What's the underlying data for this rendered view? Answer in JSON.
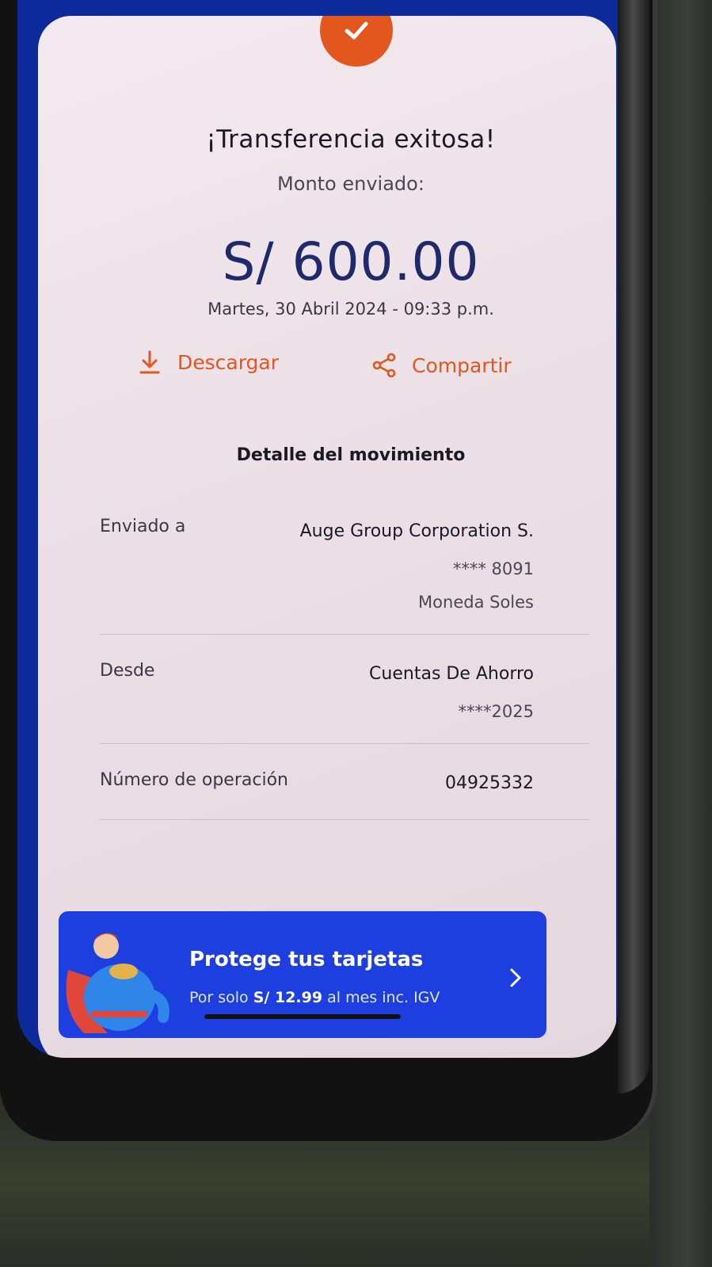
{
  "colors": {
    "accent": "#e3561e",
    "navy": "#1f2a6b",
    "banner_blue": "#1d3fe0",
    "card_bg": "#f3e9ee"
  },
  "status_icon": "check-icon",
  "header": {
    "title": "¡Transferencia exitosa!",
    "subtitle": "Monto enviado:",
    "amount": "S/ 600.00",
    "datetime": "Martes, 30 Abril 2024 - 09:33 p.m."
  },
  "actions": {
    "download_label": "Descargar",
    "download_icon": "download-icon",
    "share_label": "Compartir",
    "share_icon": "share-icon"
  },
  "detail": {
    "section_title": "Detalle del movimiento",
    "sent_to": {
      "label": "Enviado a",
      "name": "Auge Group Corporation S.",
      "account": "**** 8091",
      "currency": "Moneda Soles"
    },
    "from": {
      "label": "Desde",
      "account_type": "Cuentas De Ahorro",
      "account": "****2025"
    },
    "operation": {
      "label": "Número de operación",
      "number": "04925332"
    }
  },
  "banner": {
    "title": "Protege tus tarjetas",
    "sub_prefix": "Por solo",
    "sub_price": "S/ 12.99",
    "sub_suffix": "al mes inc. IGV",
    "icon": "chevron-right-icon"
  }
}
